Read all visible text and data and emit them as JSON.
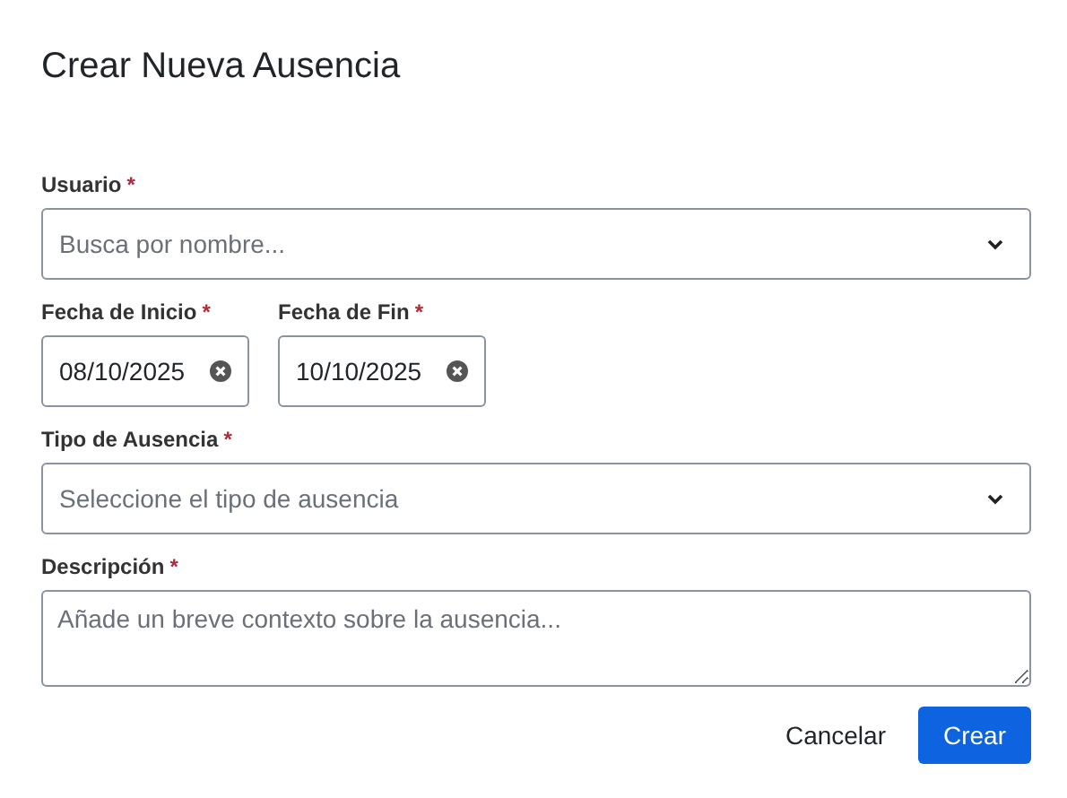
{
  "dialog": {
    "title": "Crear Nueva Ausencia"
  },
  "fields": [
    {
      "kind": "select",
      "label": "Usuario",
      "required_mark": "*",
      "placeholder": "Busca por nombre..."
    },
    {
      "kind": "dates",
      "items": [
        {
          "label": "Fecha de Inicio",
          "required_mark": "*",
          "value": "08/10/2025"
        },
        {
          "label": "Fecha de Fin",
          "required_mark": "*",
          "value": "10/10/2025"
        }
      ]
    },
    {
      "kind": "select",
      "label": "Tipo de Ausencia",
      "required_mark": "*",
      "placeholder": "Seleccione el tipo de ausencia"
    },
    {
      "kind": "textarea",
      "label": "Descripción",
      "required_mark": "*",
      "placeholder": "Añade un breve contexto sobre la ausencia..."
    }
  ],
  "buttons": [
    {
      "kind": "secondary",
      "label": "Cancelar"
    },
    {
      "kind": "primary",
      "label": "Crear"
    }
  ]
}
